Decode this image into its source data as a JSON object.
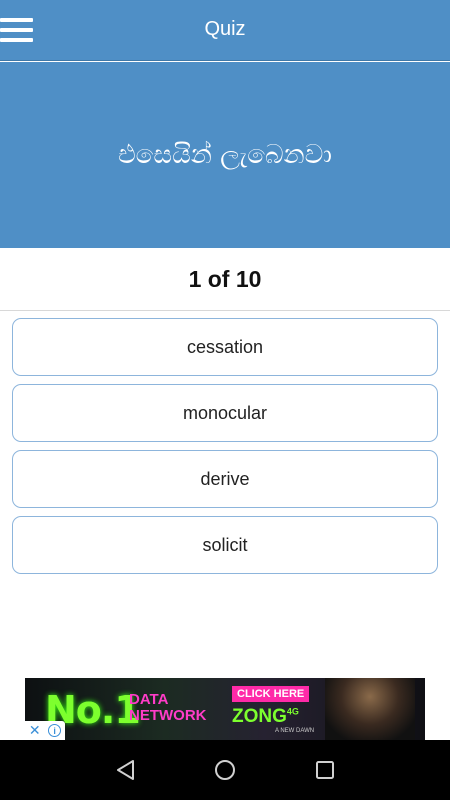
{
  "appbar": {
    "title": "Quiz",
    "menu_icon": "hamburger-menu-icon"
  },
  "question": {
    "text": "එසෙයින් ලැබෙනවා"
  },
  "progress": {
    "text": "1 of 10"
  },
  "options": [
    {
      "label": "cessation"
    },
    {
      "label": "monocular"
    },
    {
      "label": "derive"
    },
    {
      "label": "solicit"
    }
  ],
  "ad": {
    "headline": "No.1",
    "line1": "DATA",
    "line2": "NETWORK",
    "cta": "CLICK HERE",
    "brand": "ZONG",
    "brand_suffix": "4G",
    "tagline": "A NEW DAWN",
    "close_icon": "ad-close-icon",
    "info_icon": "ad-info-icon"
  },
  "navbar": {
    "back_icon": "back-triangle-icon",
    "home_icon": "home-circle-icon",
    "recents_icon": "recents-square-icon"
  },
  "colors": {
    "primary": "#4f8fc6",
    "option_border": "#8db5dc"
  }
}
